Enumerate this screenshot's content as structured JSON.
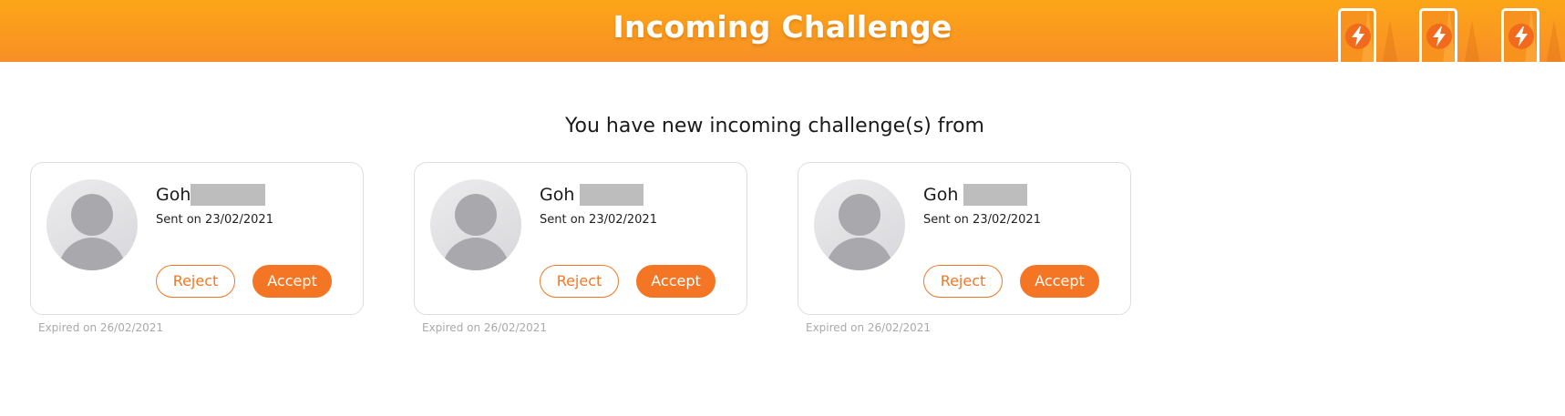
{
  "header": {
    "title": "Incoming Challenge",
    "energy_icons": [
      "lightning-card-icon",
      "lightning-card-icon",
      "lightning-card-icon"
    ]
  },
  "main": {
    "subtitle": "You have new incoming challenge(s) from"
  },
  "challenges": [
    {
      "name": "Goh",
      "sent": "Sent on 23/02/2021",
      "reject_label": "Reject",
      "accept_label": "Accept",
      "expired": "Expired on 26/02/2021"
    },
    {
      "name": "Goh",
      "sent": "Sent on 23/02/2021",
      "reject_label": "Reject",
      "accept_label": "Accept",
      "expired": "Expired on 26/02/2021"
    },
    {
      "name": "Goh",
      "sent": "Sent on 23/02/2021",
      "reject_label": "Reject",
      "accept_label": "Accept",
      "expired": "Expired on 26/02/2021"
    }
  ],
  "colors": {
    "header_top": "#fca617",
    "header_bottom": "#f88f26",
    "accent": "#f47625",
    "redaction": "#bdbdbd"
  }
}
